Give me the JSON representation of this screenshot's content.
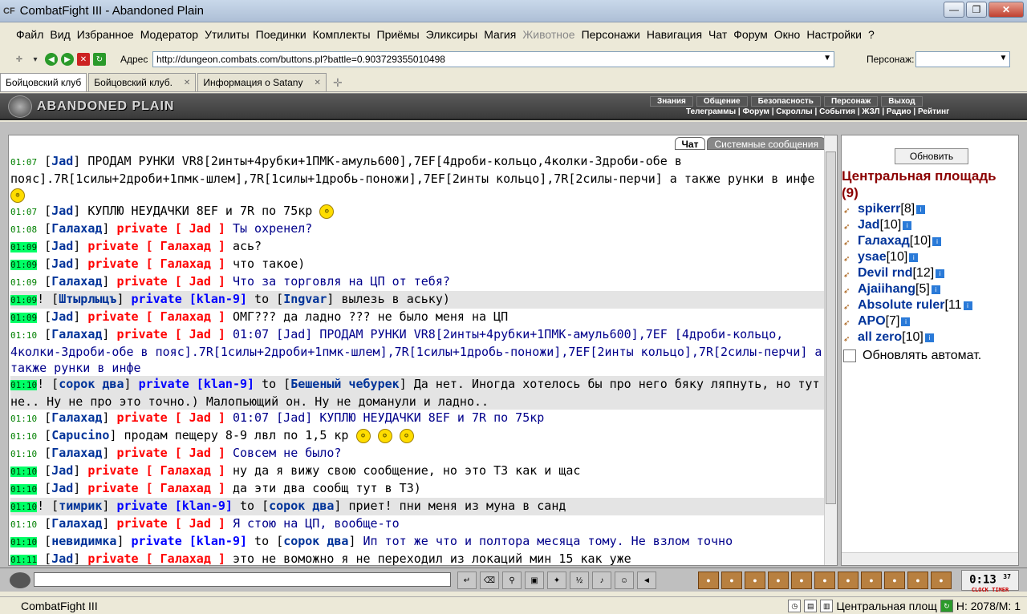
{
  "window": {
    "title": "CombatFight III - Abandoned Plain",
    "app_icon": "CF"
  },
  "menu": [
    "Файл",
    "Вид",
    "Избранное",
    "Модератор",
    "Утилиты",
    "Поединки",
    "Комплекты",
    "Приёмы",
    "Эликсиры",
    "Магия",
    "Животное",
    "Персонажи",
    "Навигация",
    "Чат",
    "Форум",
    "Окно",
    "Настройки",
    "?"
  ],
  "address": {
    "label": "Адрес",
    "url": "http://dungeon.combats.com/buttons.pl?battle=0.903729355010498",
    "persona_label": "Персонаж:"
  },
  "tabs": [
    {
      "label": "Бойцовский клуб"
    },
    {
      "label": "Бойцовский клуб."
    },
    {
      "label": "Информация о Satany"
    }
  ],
  "game": {
    "logo": "ABANDONED PLAIN",
    "topnav": [
      "Знания",
      "Общение",
      "Безопасность",
      "Персонаж",
      "Выход"
    ],
    "subnav": "Телеграммы | Форум | Скроллы | События | ЖЗЛ | Радио | Рейтинг"
  },
  "chat": {
    "tabs": [
      "Чат",
      "Системные сообщения"
    ],
    "messages": [
      {
        "ts": "01:07",
        "green": false,
        "hl": false,
        "nick": "Jad",
        "text": "ПРОДАМ РУНКИ VR8[2инты+4рубки+1ПМК-амуль600],7EF[4дроби-кольцо,4колки-3дроби-обе в пояс].7R[1силы+2дроби+1пмк-шлем],7R[1силы+1дробь-поножи],7EF[2инты кольцо],7R[2силы-перчи] а также рунки в инфе",
        "smileys": 1
      },
      {
        "ts": "01:07",
        "green": false,
        "hl": false,
        "nick": "Jad",
        "text": "КУПЛЮ НЕУДАЧКИ 8EF и 7R по 75кр",
        "smileys": 1
      },
      {
        "ts": "01:08",
        "green": false,
        "hl": false,
        "nick": "Галахад",
        "priv": "private [ Jad ]",
        "text": "Ты охренел?",
        "blue": true
      },
      {
        "ts": "01:09",
        "green": true,
        "hl": false,
        "nick": "Jad",
        "priv": "private [ Галахад ]",
        "text": "ась?"
      },
      {
        "ts": "01:09",
        "green": true,
        "hl": false,
        "nick": "Jad",
        "priv": "private [ Галахад ]",
        "text": "что такое)"
      },
      {
        "ts": "01:09",
        "green": false,
        "hl": false,
        "nick": "Галахад",
        "priv": "private [ Jad ]",
        "text": "Что за торговля на ЦП от тебя?",
        "blue": true
      },
      {
        "ts": "01:09",
        "green": true,
        "hl": true,
        "nick": "Штырлыцъ",
        "klan": "private [klan-9]",
        "to": "Ingvar",
        "text": "вылезь в аську)",
        "bang": true
      },
      {
        "ts": "01:09",
        "green": true,
        "hl": false,
        "nick": "Jad",
        "priv": "private [ Галахад ]",
        "text": "ОМГ??? да ладно ??? не было меня на ЦП"
      },
      {
        "ts": "01:10",
        "green": false,
        "hl": false,
        "nick": "Галахад",
        "priv": "private [ Jad ]",
        "text": "01:07 [Jad] ПРОДАМ РУНКИ VR8[2инты+4рубки+1ПМК-амуль600],7EF [4дроби-кольцо, 4колки-3дроби-обе в пояс].7R[1силы+2дроби+1пмк-шлем],7R[1силы+1дробь-поножи],7EF[2инты кольцо],7R[2силы-перчи] а также рунки в инфе",
        "blue": true
      },
      {
        "ts": "01:10",
        "green": true,
        "hl": true,
        "nick": "сорок два",
        "klan": "private [klan-9]",
        "to": "Бешеный чебурек",
        "text": "Да нет. Иногда хотелось бы про него бяку ляпнуть, но тут не.. Ну не про это точно.) Малопьющий он. Ну не доманули и ладно..",
        "bang": true
      },
      {
        "ts": "01:10",
        "green": false,
        "hl": false,
        "nick": "Галахад",
        "priv": "private [ Jad ]",
        "text": "01:07 [Jad] КУПЛЮ НЕУДАЧКИ 8EF и 7R по 75кр",
        "blue": true
      },
      {
        "ts": "01:10",
        "green": false,
        "hl": false,
        "nick": "Capucino",
        "text": "продам пещеру 8-9 лвл по 1,5 кр",
        "smileys": 3
      },
      {
        "ts": "01:10",
        "green": false,
        "hl": false,
        "nick": "Галахад",
        "priv": "private [ Jad ]",
        "text": "Совсем не было?",
        "blue": true
      },
      {
        "ts": "01:10",
        "green": true,
        "hl": false,
        "nick": "Jad",
        "priv": "private [ Галахад ]",
        "text": "ну да я вижу свою сообщение, но это ТЗ как и щас"
      },
      {
        "ts": "01:10",
        "green": true,
        "hl": false,
        "nick": "Jad",
        "priv": "private [ Галахад ]",
        "text": "да эти два сообщ тут в ТЗ)"
      },
      {
        "ts": "01:10",
        "green": true,
        "hl": true,
        "nick": "тимрик",
        "klan": "private [klan-9]",
        "to": "сорок два",
        "text": "приет! пни меня из муна в санд",
        "bang": true
      },
      {
        "ts": "01:10",
        "green": false,
        "hl": false,
        "nick": "Галахад",
        "priv": "private [ Jad ]",
        "text": "Я стою на ЦП, вообще-то",
        "blue": true
      },
      {
        "ts": "01:10",
        "green": true,
        "hl": false,
        "nick": "невидимка",
        "klan": "private [klan-9]",
        "to": "сорок два",
        "text": "Ип тот же что и полтора месяца тому. Не взлом точно",
        "blue": true
      },
      {
        "ts": "01:11",
        "green": true,
        "hl": false,
        "nick": "Jad",
        "priv": "private [ Галахад ]",
        "text": "это не воможно я не переходил из локаций мин 15 как уже"
      }
    ]
  },
  "side": {
    "refresh": "Обновить",
    "title": "Центральная площадь (9)",
    "users": [
      {
        "name": "spikerr",
        "level": "[8]"
      },
      {
        "name": "Jad",
        "level": "[10]"
      },
      {
        "name": "Галахад",
        "level": "[10]"
      },
      {
        "name": "ysae",
        "level": "[10]"
      },
      {
        "name": "Devil rnd",
        "level": "[12]"
      },
      {
        "name": "Ajaiihang",
        "level": "[5]"
      },
      {
        "name": "Absolute ruler",
        "level": "[11"
      },
      {
        "name": "APO",
        "level": "[7]"
      },
      {
        "name": "all zero",
        "level": "[10]"
      }
    ],
    "auto_refresh": "Обновлять автомат."
  },
  "clock": {
    "time": "0:13",
    "sec": "37",
    "label": "CLOCK TIMER"
  },
  "status": {
    "left": "CombatFight III",
    "location": "Центральная площ",
    "hm": "H: 2078/M: 1"
  }
}
